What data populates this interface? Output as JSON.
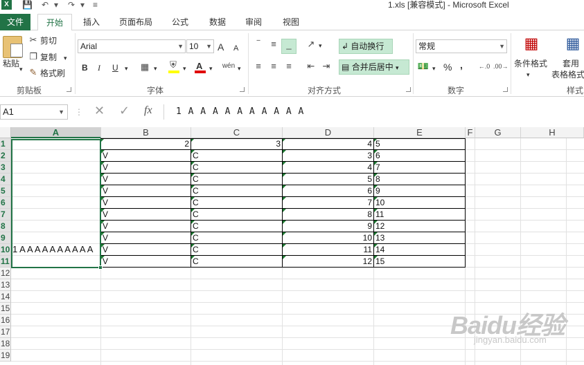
{
  "titlebar": {
    "logo": "X",
    "title": "1.xls  [兼容模式] - Microsoft Excel"
  },
  "tabs": [
    "文件",
    "开始",
    "插入",
    "页面布局",
    "公式",
    "数据",
    "审阅",
    "视图"
  ],
  "ribbon": {
    "clipboard": {
      "paste": "粘贴",
      "cut": "剪切",
      "copy": "复制",
      "format_painter": "格式刷",
      "label": "剪贴板"
    },
    "font": {
      "name": "Arial",
      "size": "10",
      "grow": "A",
      "shrink": "A",
      "bold": "B",
      "italic": "I",
      "underline": "U",
      "label": "字体"
    },
    "alignment": {
      "wrap_text": "自动换行",
      "merge_center": "合并后居中",
      "label": "对齐方式"
    },
    "number": {
      "format": "常规",
      "percent": "%",
      "comma": ",",
      "label": "数字"
    },
    "styles": {
      "conditional": "条件格式",
      "table_format_line1": "套用",
      "table_format_line2": "表格格式",
      "label": "样式"
    }
  },
  "formula_bar": {
    "name_box": "A1",
    "fx": "fx",
    "value": "1 A A A A A A A A A A"
  },
  "grid": {
    "columns": [
      "A",
      "B",
      "C",
      "D",
      "E",
      "F",
      "G",
      "H"
    ],
    "rows": [
      "1",
      "2",
      "3",
      "4",
      "5",
      "6",
      "7",
      "8",
      "9",
      "10",
      "11",
      "12",
      "13",
      "14",
      "15",
      "16",
      "17",
      "18",
      "19"
    ],
    "selected_column": "A",
    "merged_a": "1 A A A A A A A A A A",
    "row1": {
      "b": "2",
      "c": "3",
      "d": "4",
      "e": "5"
    },
    "data": [
      {
        "b": "V",
        "c": "C",
        "d": "3",
        "e": "6"
      },
      {
        "b": "V",
        "c": "C",
        "d": "4",
        "e": "7"
      },
      {
        "b": "V",
        "c": "C",
        "d": "5",
        "e": "8"
      },
      {
        "b": "V",
        "c": "C",
        "d": "6",
        "e": "9"
      },
      {
        "b": "V",
        "c": "C",
        "d": "7",
        "e": "10"
      },
      {
        "b": "V",
        "c": "C",
        "d": "8",
        "e": "11"
      },
      {
        "b": "V",
        "c": "C",
        "d": "9",
        "e": "12"
      },
      {
        "b": "V",
        "c": "C",
        "d": "10",
        "e": "13"
      },
      {
        "b": "V",
        "c": "C",
        "d": "11",
        "e": "14"
      },
      {
        "b": "V",
        "c": "C",
        "d": "12",
        "e": "15"
      }
    ]
  },
  "watermark": {
    "brand": "Baidu经验",
    "url": "jingyan.baidu.com"
  }
}
